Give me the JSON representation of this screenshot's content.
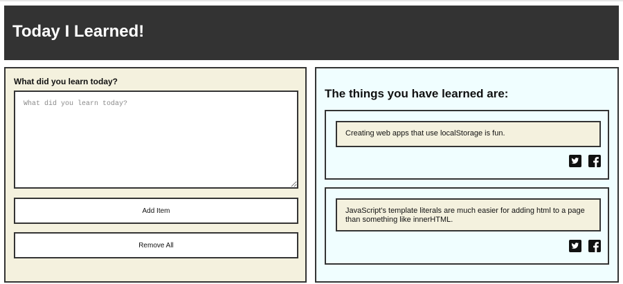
{
  "header": {
    "title": "Today I Learned!"
  },
  "form": {
    "label": "What did you learn today?",
    "placeholder": "What did you learn today?",
    "value": "",
    "add_button": "Add Item",
    "remove_button": "Remove All"
  },
  "learned": {
    "heading": "The things you have learned are:",
    "items": [
      {
        "text": "Creating web apps that use localStorage is fun."
      },
      {
        "text": "JavaScript's template literals are much easier for adding html to a page than something like innerHTML."
      }
    ]
  },
  "icons": {
    "share_twitter": "twitter-icon",
    "share_facebook": "facebook-icon"
  },
  "colors": {
    "header_bg": "#333333",
    "left_panel_bg": "#f4f1de",
    "right_panel_bg": "#f0feff",
    "border": "#333333"
  }
}
